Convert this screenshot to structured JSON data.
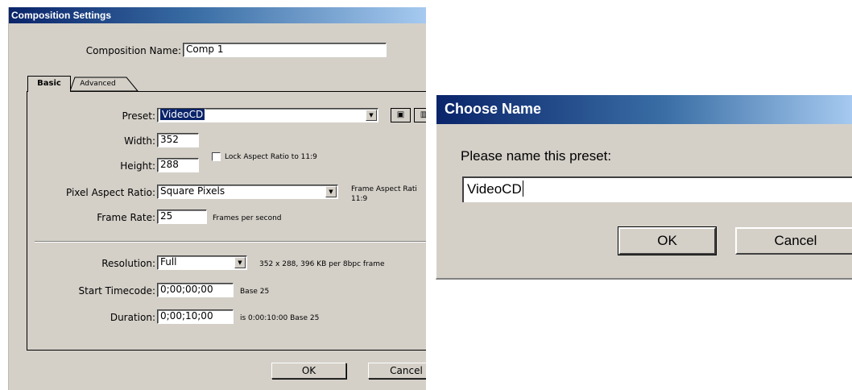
{
  "composition_settings": {
    "title": "Composition Settings",
    "composition_name_label": "Composition Name:",
    "composition_name_value": "Comp 1",
    "tabs": [
      {
        "label": "Basic",
        "active": true
      },
      {
        "label": "Advanced",
        "active": false
      }
    ],
    "preset_label": "Preset:",
    "preset_value": "VideoCD",
    "width_label": "Width:",
    "width_value": "352",
    "height_label": "Height:",
    "height_value": "288",
    "lock_aspect_label": "Lock Aspect Ratio to 11:9",
    "lock_aspect_checked": false,
    "pixel_aspect_label": "Pixel Aspect Ratio:",
    "pixel_aspect_value": "Square Pixels",
    "frame_aspect_label": "Frame Aspect Rati",
    "frame_aspect_value": "11:9",
    "frame_rate_label": "Frame Rate:",
    "frame_rate_value": "25",
    "frame_rate_unit": "Frames per second",
    "resolution_label": "Resolution:",
    "resolution_value": "Full",
    "resolution_info": "352 x 288, 396 KB per 8bpc frame",
    "start_timecode_label": "Start Timecode:",
    "start_timecode_value": "0;00;00;00",
    "start_timecode_base": "Base 25",
    "duration_label": "Duration:",
    "duration_value": "0;00;10;00",
    "duration_info": "is 0:00:10:00  Base 25",
    "ok_label": "OK",
    "cancel_label": "Cancel"
  },
  "choose_name": {
    "title": "Choose Name",
    "prompt": "Please name this preset:",
    "input_value": "VideoCD",
    "ok_label": "OK",
    "cancel_label": "Cancel"
  },
  "colors": {
    "titlebar": "#0a246a",
    "dialog_face": "#d4d0c8",
    "selection": "#0a246a"
  }
}
